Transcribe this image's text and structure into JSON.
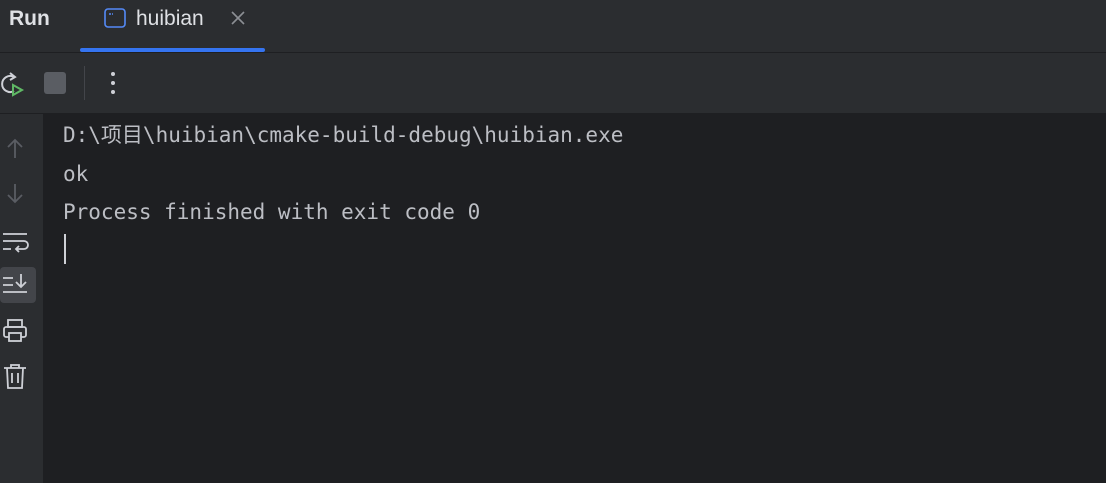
{
  "header": {
    "title": "Run",
    "tab": {
      "label": "huibian",
      "icon": "console-window-icon",
      "close_icon": "close-icon"
    }
  },
  "toolbar": {
    "buttons": [
      {
        "name": "rerun",
        "icon": "rerun-icon"
      },
      {
        "name": "stop",
        "icon": "stop-icon"
      },
      {
        "name": "more",
        "icon": "more-vertical-icon"
      }
    ]
  },
  "sidebar": {
    "buttons": [
      {
        "name": "scroll-up",
        "icon": "arrow-up-icon"
      },
      {
        "name": "scroll-down",
        "icon": "arrow-down-icon"
      },
      {
        "name": "soft-wrap",
        "icon": "soft-wrap-icon"
      },
      {
        "name": "scroll-to-end",
        "icon": "scroll-to-end-icon",
        "active": true
      },
      {
        "name": "print",
        "icon": "print-icon"
      },
      {
        "name": "clear",
        "icon": "trash-icon"
      }
    ]
  },
  "console": {
    "lines": [
      "D:\\项目\\huibian\\cmake-build-debug\\huibian.exe",
      "ok",
      "Process finished with exit code 0"
    ]
  },
  "colors": {
    "background": "#1e1f22",
    "panel": "#2b2d30",
    "accent": "#3574f0",
    "text": "#bcbec4",
    "run_green": "#5fb865"
  }
}
